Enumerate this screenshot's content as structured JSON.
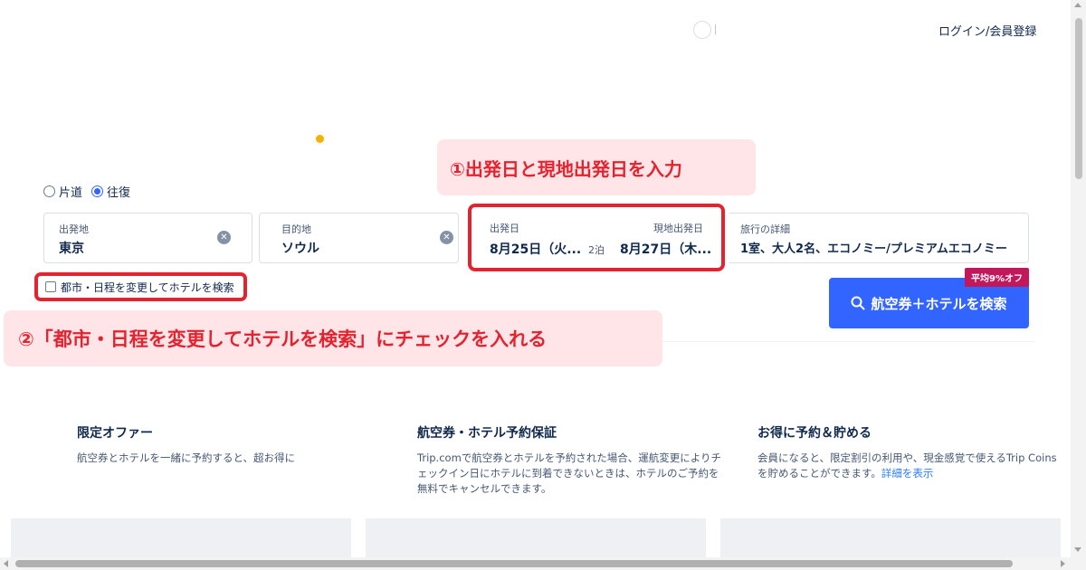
{
  "header": {
    "login_label": "ログイン/会員登録"
  },
  "callouts": {
    "step1": "①出発日と現地出発日を入力",
    "step2": "②「都市・日程を変更してホテルを検索」にチェックを入れる"
  },
  "trip_type": {
    "one_way": "片道",
    "round_trip": "往復",
    "selected": "往復"
  },
  "search_form": {
    "from": {
      "label": "出発地",
      "value": "東京"
    },
    "to": {
      "label": "目的地",
      "value": "ソウル"
    },
    "dates": {
      "depart_label": "出発日",
      "depart_value": "8月25日（火...",
      "nights": "2泊",
      "return_label": "現地出発日",
      "return_value": "8月27日（木..."
    },
    "details": {
      "label": "旅行の詳細",
      "value": "1室、大人2名、エコノミー/プレミアムエコノミー"
    },
    "hotel_checkbox_label": "都市・日程を変更してホテルを検索",
    "hotel_checkbox_checked": false,
    "search_button_label": "航空券＋ホテルを検索",
    "discount_badge": "平均9%オフ"
  },
  "features": [
    {
      "title": "限定オファー",
      "text": "航空券とホテルを一緒に予約すると、超お得に"
    },
    {
      "title": "航空券・ホテル予約保証",
      "text": "Trip.comで航空券とホテルを予約された場合、運航変更によりチェックイン日にホテルに到着できないときは、ホテルのご予約を無料でキャンセルできます。"
    },
    {
      "title": "お得に予約＆貯める",
      "text": "会員になると、限定割引の利用や、現金感覚で使えるTrip Coins を貯めることができます。",
      "link": "詳細を表示"
    }
  ],
  "colors": {
    "accent": "#3264ff",
    "callout_text": "#e3232f",
    "callout_bg": "#ffe5e7",
    "badge": "#c2185b"
  }
}
